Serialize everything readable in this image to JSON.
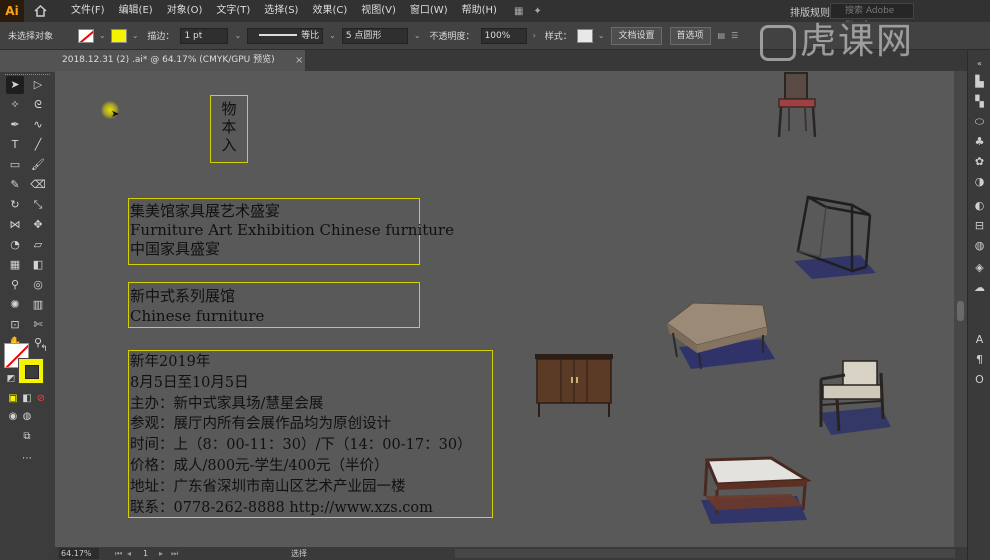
{
  "app": {
    "logo": "Ai",
    "menu": [
      "文件(F)",
      "编辑(E)",
      "对象(O)",
      "文字(T)",
      "选择(S)",
      "效果(C)",
      "视图(V)",
      "窗口(W)",
      "帮助(H)"
    ],
    "workspace": "排版规则",
    "search_placeholder": "搜索 Adobe Stock",
    "watermark": "虎课网"
  },
  "control_bar": {
    "no_selection": "未选择对象",
    "stroke_label": "描边：",
    "stroke_value": "1 pt",
    "stroke_profile": "等比",
    "brush_value": "5 点圆形",
    "opacity_label": "不透明度：",
    "opacity_value": "100%",
    "style_label": "样式：",
    "doc_setup": "文档设置",
    "preferences": "首选项",
    "colors": {
      "fill": "none",
      "stroke": "#f4f400"
    }
  },
  "document": {
    "tab_title": "2018.12.31 (2) .ai* @ 64.17% (CMYK/GPU 预览)",
    "tab_close": "×"
  },
  "artwork": {
    "logo_chars": [
      "物",
      "本",
      "入"
    ],
    "title_lines": [
      "集美馆家具展艺术盛宴",
      "Furniture Art Exhibition Chinese furniture",
      "中国家具盛宴"
    ],
    "hall_lines": [
      "新中式系列展馆",
      "Chinese furniture"
    ],
    "info_lines": [
      "新年2019年",
      "8月5日至10月5日",
      "主办：新中式家具场/慧星会展",
      "参观：展厅内所有会展作品均为原创设计",
      "时间：上（8：00-11：30）/下（14：00-17：30）",
      "价格：成人/800元-学生/400元（半价）",
      "地址：广东省深圳市南山区艺术产业园一楼",
      "联系：0778-262-8888 http://www.xzs.com"
    ]
  },
  "status": {
    "zoom": "64.17%",
    "page": "1",
    "tool_label": "选择"
  }
}
